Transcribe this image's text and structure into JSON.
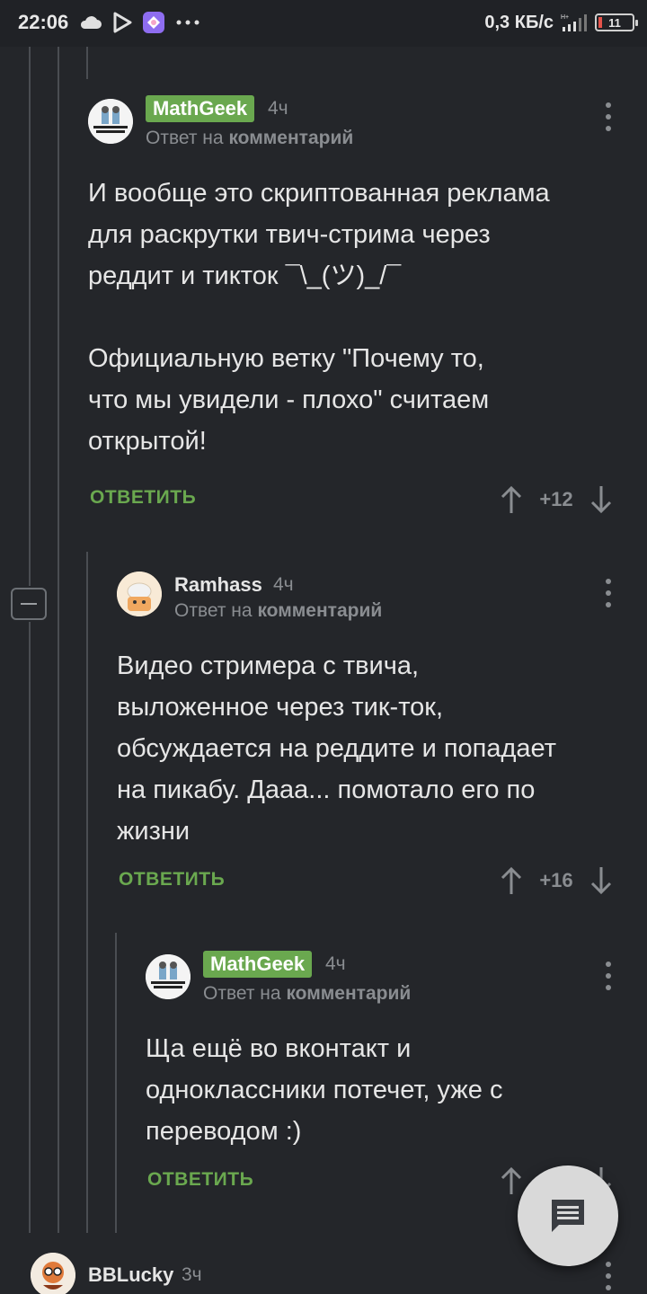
{
  "status_bar": {
    "time": "22:06",
    "speed": "0,3 КБ/с",
    "battery": "11",
    "icons": [
      "cloud-icon",
      "play-store-icon",
      "app-icon",
      "more-icon"
    ]
  },
  "comments": [
    {
      "author": "MathGeek",
      "author_badge": true,
      "time": "4ч",
      "reply_prefix": "Ответ на",
      "reply_target": "комментарий",
      "body": "И вообще это скриптованная реклама\nдля раскрутки твич-стрима через\nреддит и тикток ¯\\_(ツ)_/¯\n\nОфициальную ветку \"Почему то,\nчто мы увидели - плохо\" считаем\nоткрытой!",
      "reply_label": "ОТВЕТИТЬ",
      "score": "+12"
    },
    {
      "author": "Ramhass",
      "author_badge": false,
      "time": "4ч",
      "reply_prefix": "Ответ на",
      "reply_target": "комментарий",
      "body": "Видео стримера с твича,\nвыложенное через тик-ток,\nобсуждается на реддите и попадает\nна пикабу. Дааа... помотало его по\nжизни",
      "reply_label": "ОТВЕТИТЬ",
      "score": "+16"
    },
    {
      "author": "MathGeek",
      "author_badge": true,
      "time": "4ч",
      "reply_prefix": "Ответ на",
      "reply_target": "комментарий",
      "body": "Ща ещё во вконтакт и\nодноклассники потечет, уже с\nпереводом :)",
      "reply_label": "ОТВЕТИТЬ",
      "score": ""
    },
    {
      "author": "BBLucky",
      "author_badge": false,
      "time": "3ч"
    }
  ],
  "colors": {
    "background": "#24262a",
    "accent_green": "#6aa84f",
    "muted": "#8a8d91"
  }
}
